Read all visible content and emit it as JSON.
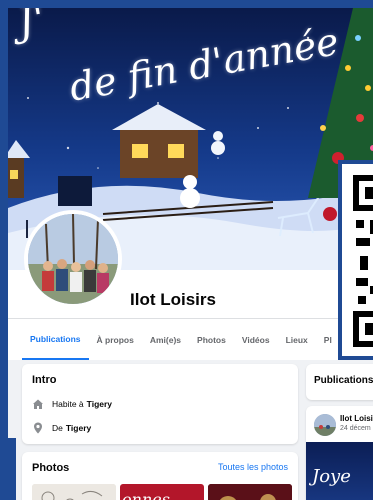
{
  "cover": {
    "line1": "J'",
    "line2": "de fin d'année"
  },
  "profile": {
    "name": "Ilot Loisirs"
  },
  "tabs": [
    {
      "label": "Publications",
      "active": true
    },
    {
      "label": "À propos",
      "active": false
    },
    {
      "label": "Ami(e)s",
      "active": false
    },
    {
      "label": "Photos",
      "active": false
    },
    {
      "label": "Vidéos",
      "active": false
    },
    {
      "label": "Lieux",
      "active": false
    },
    {
      "label": "Pl",
      "active": false
    }
  ],
  "intro": {
    "title": "Intro",
    "rows": [
      {
        "icon": "home-icon",
        "prefix": "Habite à",
        "value": "Tigery"
      },
      {
        "icon": "location-pin-icon",
        "prefix": "De",
        "value": "Tigery"
      }
    ]
  },
  "photos": {
    "title": "Photos",
    "link": "Toutes les photos",
    "thumb2_text": "onnes"
  },
  "publications": {
    "title": "Publications",
    "author": "Ilot Loisirs",
    "date": "24 décem",
    "image_text": "Joye"
  },
  "colors": {
    "accent": "#1877f2",
    "frame": "#1f4a94",
    "background": "#f0f2f5"
  }
}
